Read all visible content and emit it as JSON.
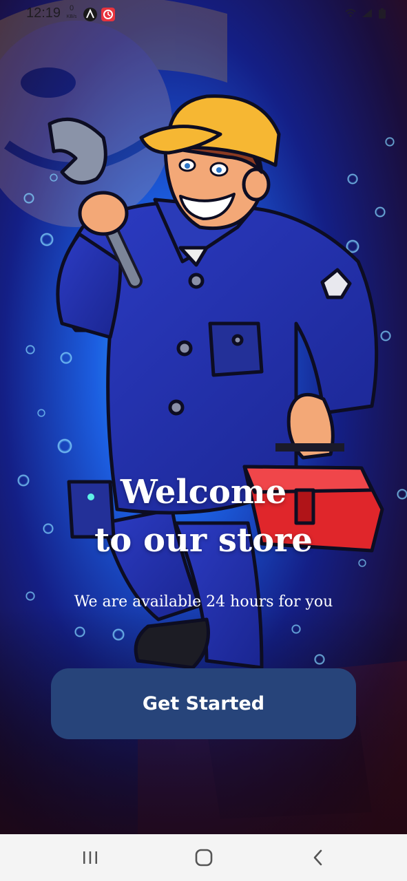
{
  "status_bar": {
    "time": "12:19",
    "net_speed_value": "0",
    "net_speed_unit": "KB/s",
    "icons": [
      "a-app-icon",
      "alarm-app-icon",
      "wifi-icon",
      "signal-icon",
      "battery-icon"
    ]
  },
  "welcome": {
    "title_line1": "Welcome",
    "title_line2": "to our store",
    "subtitle": "We are available 24 hours for you",
    "button_label": "Get Started"
  },
  "nav_bar": {
    "icons": [
      "recent-apps-icon",
      "home-icon",
      "back-icon"
    ]
  },
  "colors": {
    "button_bg": "#27447a",
    "overall_uniform": "#1f2aa8",
    "cap": "#f6b733",
    "toolbox": "#e0262b",
    "nav_bg": "#f4f4f4"
  }
}
